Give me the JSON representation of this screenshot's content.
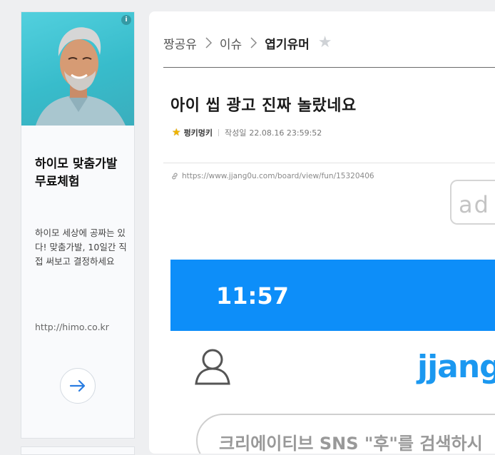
{
  "ad": {
    "title": "하이모 맞춤가발 무료체험",
    "description": "하이모 세상에 공짜는 있다! 맞춤가발, 10일간 직접 써보고 결정하세요",
    "url": "http://himo.co.kr",
    "info_label": "i"
  },
  "breadcrumb": {
    "items": [
      "짱공유",
      "이슈"
    ],
    "current": "엽기유머"
  },
  "post": {
    "title": "아이 씹 광고 진짜 놀랐네요",
    "author": "펑키멍키",
    "date_label": "작성일",
    "date": "22.08.16 23:59:52",
    "url": "https://www.jjang0u.com/board/view/fun/15320406"
  },
  "ad_badge": {
    "label": "ad"
  },
  "embedded_image": {
    "time": "11:57",
    "logo": "jjang",
    "search_text": "크리에이티브 SNS \"후\"를 검색하시"
  }
}
